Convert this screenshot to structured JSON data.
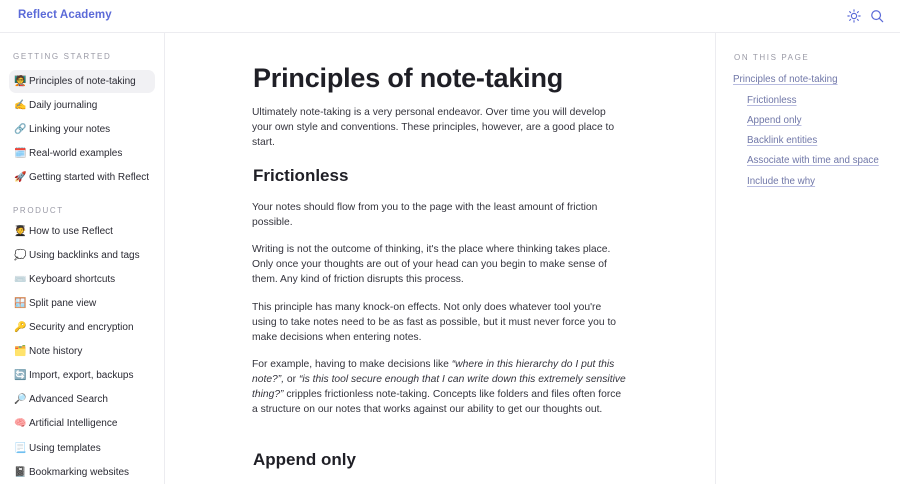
{
  "app": {
    "brand": "Reflect Academy"
  },
  "sidebar": {
    "sections": [
      {
        "title": "GETTING STARTED",
        "items": [
          {
            "emoji": "🧑‍🏫",
            "label": "Principles of note-taking",
            "active": true
          },
          {
            "emoji": "✍️",
            "label": "Daily journaling"
          },
          {
            "emoji": "🔗",
            "label": "Linking your notes"
          },
          {
            "emoji": "🗓️",
            "label": "Real-world examples"
          },
          {
            "emoji": "🚀",
            "label": "Getting started with Reflect"
          }
        ]
      },
      {
        "title": "PRODUCT",
        "items": [
          {
            "emoji": "🧑‍🎓",
            "label": "How to use Reflect"
          },
          {
            "emoji": "💭",
            "label": "Using backlinks and tags"
          },
          {
            "emoji": "⌨️",
            "label": "Keyboard shortcuts"
          },
          {
            "emoji": "🪟",
            "label": "Split pane view"
          },
          {
            "emoji": "🔑",
            "label": "Security and encryption"
          },
          {
            "emoji": "🗂️",
            "label": "Note history"
          },
          {
            "emoji": "🔄",
            "label": "Import, export, backups"
          },
          {
            "emoji": "🔎",
            "label": "Advanced Search"
          },
          {
            "emoji": "🧠",
            "label": "Artificial Intelligence"
          },
          {
            "emoji": "📃",
            "label": "Using templates"
          },
          {
            "emoji": "📓",
            "label": "Bookmarking websites"
          }
        ]
      }
    ]
  },
  "main": {
    "title": "Principles of note-taking",
    "intro": "Ultimately note-taking is a very personal endeavor. Over time you will develop your own style and conventions. These principles, however, are a good place to start.",
    "sections": [
      {
        "heading": "Frictionless",
        "paragraphs": [
          "Your notes should flow from you to the page with the least amount of friction possible.",
          "Writing is not the outcome of thinking, it's the place where thinking takes place. Only once your thoughts are out of your head can you begin to make sense of them. Any kind of friction disrupts this process.",
          "This principle has many knock-on effects. Not only does whatever tool you're using to take notes need to be as fast as possible, but it must never force you to make decisions when entering notes."
        ],
        "example": {
          "lead": "For example, having to make decisions like ",
          "quote1": "“where in this hierarchy do I put this note?”,",
          "mid": " or ",
          "quote2": "“is this tool secure enough that I can write down this extremely sensitive thing?”",
          "tail": " cripples frictionless note-taking. Concepts like folders and files often force a structure on our notes that works against our ability to get our thoughts out."
        }
      },
      {
        "heading": "Append only"
      }
    ]
  },
  "toc": {
    "title": "ON THIS PAGE",
    "links": [
      {
        "label": "Principles of note-taking",
        "level": 1
      },
      {
        "label": "Frictionless",
        "level": 2
      },
      {
        "label": "Append only",
        "level": 2
      },
      {
        "label": "Backlink entities",
        "level": 2
      },
      {
        "label": "Associate with time and space",
        "level": 2
      },
      {
        "label": "Include the why",
        "level": 2
      }
    ]
  }
}
